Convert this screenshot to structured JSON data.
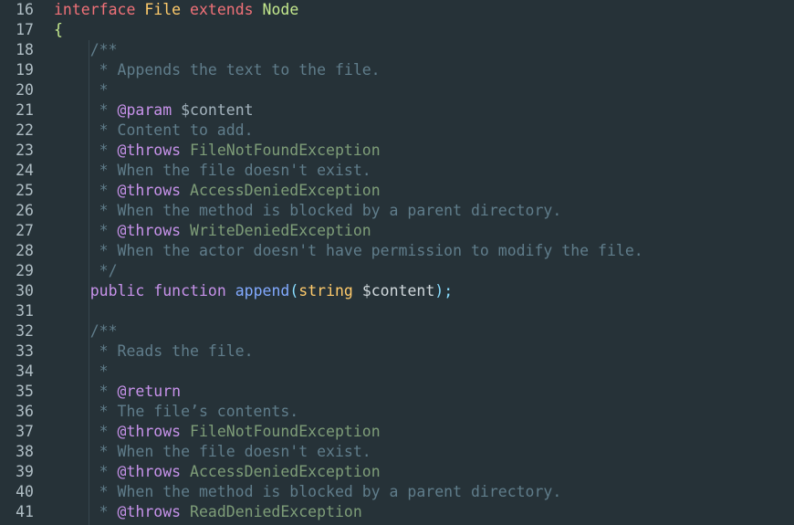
{
  "editor": {
    "lines": [
      {
        "n": "16",
        "segs": [
          [
            "interface",
            "kw2"
          ],
          [
            " ",
            "plain"
          ],
          [
            "File",
            "typename"
          ],
          [
            " ",
            "plain"
          ],
          [
            "extends",
            "kw2"
          ],
          [
            " ",
            "plain"
          ],
          [
            "Node",
            "brace"
          ]
        ]
      },
      {
        "n": "17",
        "segs": [
          [
            "{",
            "brace"
          ]
        ]
      },
      {
        "n": "18",
        "segs": [
          [
            "    /**",
            "comment"
          ]
        ]
      },
      {
        "n": "19",
        "segs": [
          [
            "     * Appends the text to the file.",
            "comment"
          ]
        ]
      },
      {
        "n": "20",
        "segs": [
          [
            "     *",
            "comment"
          ]
        ]
      },
      {
        "n": "21",
        "segs": [
          [
            "     * ",
            "comment"
          ],
          [
            "@param",
            "tag"
          ],
          [
            " $content",
            "cvar"
          ]
        ]
      },
      {
        "n": "22",
        "segs": [
          [
            "     * Content to add.",
            "comment"
          ]
        ]
      },
      {
        "n": "23",
        "segs": [
          [
            "     * ",
            "comment"
          ],
          [
            "@throws",
            "tag"
          ],
          [
            " FileNotFoundException",
            "ctype"
          ]
        ]
      },
      {
        "n": "24",
        "segs": [
          [
            "     * When the file doesn't exist.",
            "comment"
          ]
        ]
      },
      {
        "n": "25",
        "segs": [
          [
            "     * ",
            "comment"
          ],
          [
            "@throws",
            "tag"
          ],
          [
            " AccessDeniedException",
            "ctype"
          ]
        ]
      },
      {
        "n": "26",
        "segs": [
          [
            "     * When the method is blocked by a parent directory.",
            "comment"
          ]
        ]
      },
      {
        "n": "27",
        "segs": [
          [
            "     * ",
            "comment"
          ],
          [
            "@throws",
            "tag"
          ],
          [
            " WriteDeniedException",
            "ctype"
          ]
        ]
      },
      {
        "n": "28",
        "segs": [
          [
            "     * When the actor doesn't have permission to modify the file.",
            "comment"
          ]
        ]
      },
      {
        "n": "29",
        "segs": [
          [
            "     */",
            "comment"
          ]
        ]
      },
      {
        "n": "30",
        "segs": [
          [
            "    ",
            "plain"
          ],
          [
            "public",
            "kw"
          ],
          [
            " ",
            "plain"
          ],
          [
            "function",
            "kw"
          ],
          [
            " ",
            "plain"
          ],
          [
            "append",
            "fn"
          ],
          [
            "(",
            "paren"
          ],
          [
            "string",
            "type"
          ],
          [
            " ",
            "plain"
          ],
          [
            "$content",
            "plain"
          ],
          [
            ")",
            "paren"
          ],
          [
            ";",
            "paren"
          ]
        ]
      },
      {
        "n": "31",
        "segs": []
      },
      {
        "n": "32",
        "segs": [
          [
            "    /**",
            "comment"
          ]
        ]
      },
      {
        "n": "33",
        "segs": [
          [
            "     * Reads the file.",
            "comment"
          ]
        ]
      },
      {
        "n": "34",
        "segs": [
          [
            "     *",
            "comment"
          ]
        ]
      },
      {
        "n": "35",
        "segs": [
          [
            "     * ",
            "comment"
          ],
          [
            "@return",
            "tag"
          ]
        ]
      },
      {
        "n": "36",
        "segs": [
          [
            "     * The file’s contents.",
            "comment"
          ]
        ]
      },
      {
        "n": "37",
        "segs": [
          [
            "     * ",
            "comment"
          ],
          [
            "@throws",
            "tag"
          ],
          [
            " FileNotFoundException",
            "ctype"
          ]
        ]
      },
      {
        "n": "38",
        "segs": [
          [
            "     * When the file doesn't exist.",
            "comment"
          ]
        ]
      },
      {
        "n": "39",
        "segs": [
          [
            "     * ",
            "comment"
          ],
          [
            "@throws",
            "tag"
          ],
          [
            " AccessDeniedException",
            "ctype"
          ]
        ]
      },
      {
        "n": "40",
        "segs": [
          [
            "     * When the method is blocked by a parent directory.",
            "comment"
          ]
        ]
      },
      {
        "n": "41",
        "segs": [
          [
            "     * ",
            "comment"
          ],
          [
            "@throws",
            "tag"
          ],
          [
            " ReadDeniedException",
            "ctype"
          ]
        ]
      }
    ]
  },
  "colors": {
    "background": "#263238",
    "line_number": "#b0bec5",
    "comment": "#607d8b",
    "keyword": "#c792ea",
    "function": "#82aaff",
    "type": "#ffcb6b"
  }
}
